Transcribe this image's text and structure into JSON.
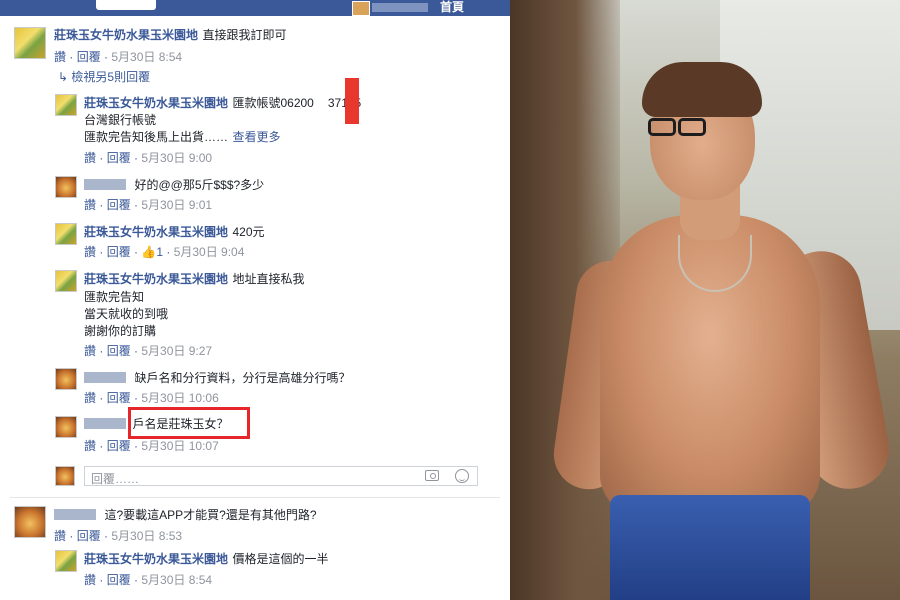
{
  "topbar": {
    "home_label": "首頁"
  },
  "thread": {
    "top_comment": {
      "author": "莊珠玉女牛奶水果玉米園地",
      "text": "直接跟我訂即可",
      "like": "讚",
      "reply": "回覆",
      "time": "5月30日 8:54"
    },
    "view_more_replies": "檢視另5則回覆",
    "replies": [
      {
        "author": "莊珠玉女牛奶水果玉米園地",
        "lines": [
          "匯款帳號06200",
          "37195",
          "台灣銀行帳號",
          "匯款完告知後馬上出貨……",
          "查看更多"
        ],
        "like": "讚",
        "reply": "回覆",
        "time": "5月30日 9:00"
      },
      {
        "author": "",
        "text": "好的@@那5斤$$$?多少",
        "like": "讚",
        "reply": "回覆",
        "time": "5月30日 9:01"
      },
      {
        "author": "莊珠玉女牛奶水果玉米園地",
        "text": "420元",
        "like": "讚",
        "reply": "回覆",
        "likes_count": "1",
        "time": "5月30日 9:04"
      },
      {
        "author": "莊珠玉女牛奶水果玉米園地",
        "lines": [
          "地址直接私我",
          "匯款完告知",
          "當天就收的到哦",
          "謝謝你的訂購"
        ],
        "like": "讚",
        "reply": "回覆",
        "time": "5月30日 9:27"
      },
      {
        "author": "",
        "text": "缺戶名和分行資料，分行是高雄分行嗎？",
        "like": "讚",
        "reply": "回覆",
        "time": "5月30日 10:06"
      },
      {
        "author": "",
        "text": "戶名是莊珠玉女？",
        "like": "讚",
        "reply": "回覆",
        "time": "5月30日 10:07"
      }
    ],
    "reply_placeholder": "回覆……"
  },
  "second_thread": {
    "top_comment": {
      "author": "",
      "text": "這?要載這APP才能買?還是有其他門路?",
      "like": "讚",
      "reply": "回覆",
      "time": "5月30日 8:53"
    },
    "reply": {
      "author": "莊珠玉女牛奶水果玉米園地",
      "text": "價格是這個的一半",
      "like": "讚",
      "reply": "回覆",
      "time": "5月30日 8:54"
    }
  },
  "colors": {
    "fb_blue": "#3b5998",
    "highlight_red": "#e5262a"
  },
  "icons": [
    "camera-icon",
    "emoji-icon",
    "like-thumb-icon",
    "reply-arrow-icon"
  ]
}
